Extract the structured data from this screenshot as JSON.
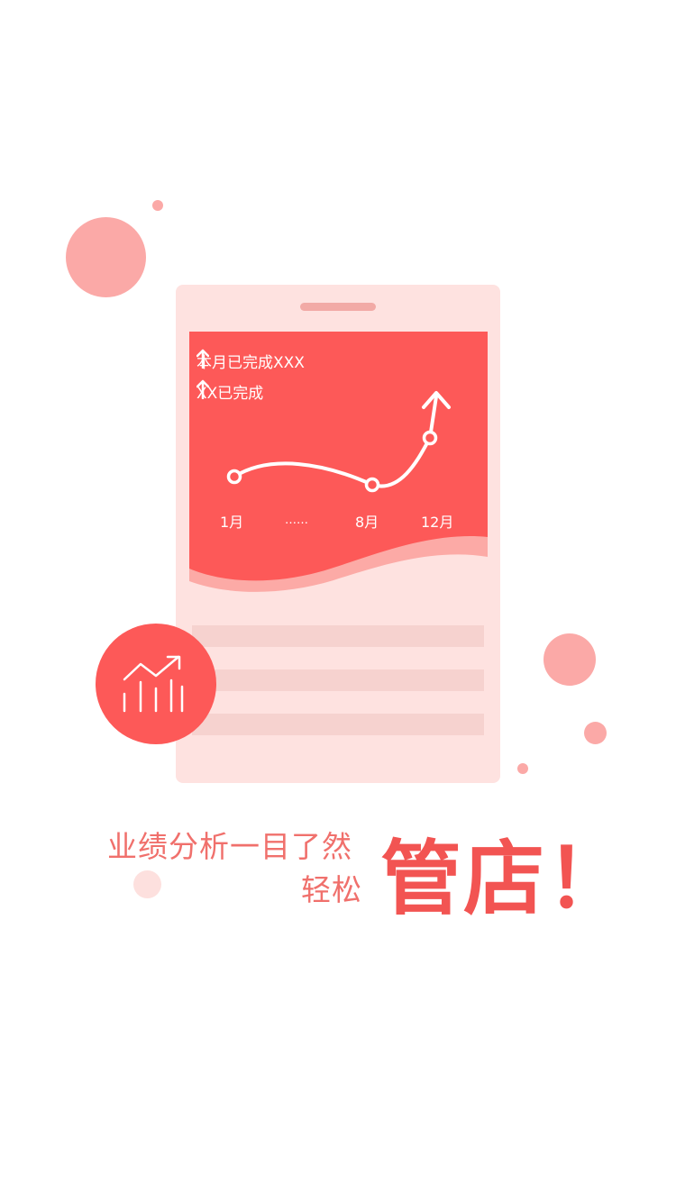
{
  "stats": [
    {
      "label": "本月已完成XXX",
      "icon": "arrow-up-icon"
    },
    {
      "label": "XX已完成",
      "icon": "arrow-up-icon"
    }
  ],
  "chart_data": {
    "type": "line",
    "x": [
      "1月",
      "……",
      "8月",
      "12月"
    ],
    "tick_labels": [
      "1月",
      "……",
      "8月",
      "12月"
    ],
    "trend": "up"
  },
  "badge": {
    "icon": "trend-chart-icon"
  },
  "slogan": {
    "line1": "业绩分析一目了然",
    "line2": "轻松",
    "headline": "管店！"
  },
  "colors": {
    "accent": "#fd5958",
    "card": "#fee2e0",
    "bubble": "#fba9a7",
    "text_light": "#f0706c",
    "text_strong": "#f25452"
  }
}
